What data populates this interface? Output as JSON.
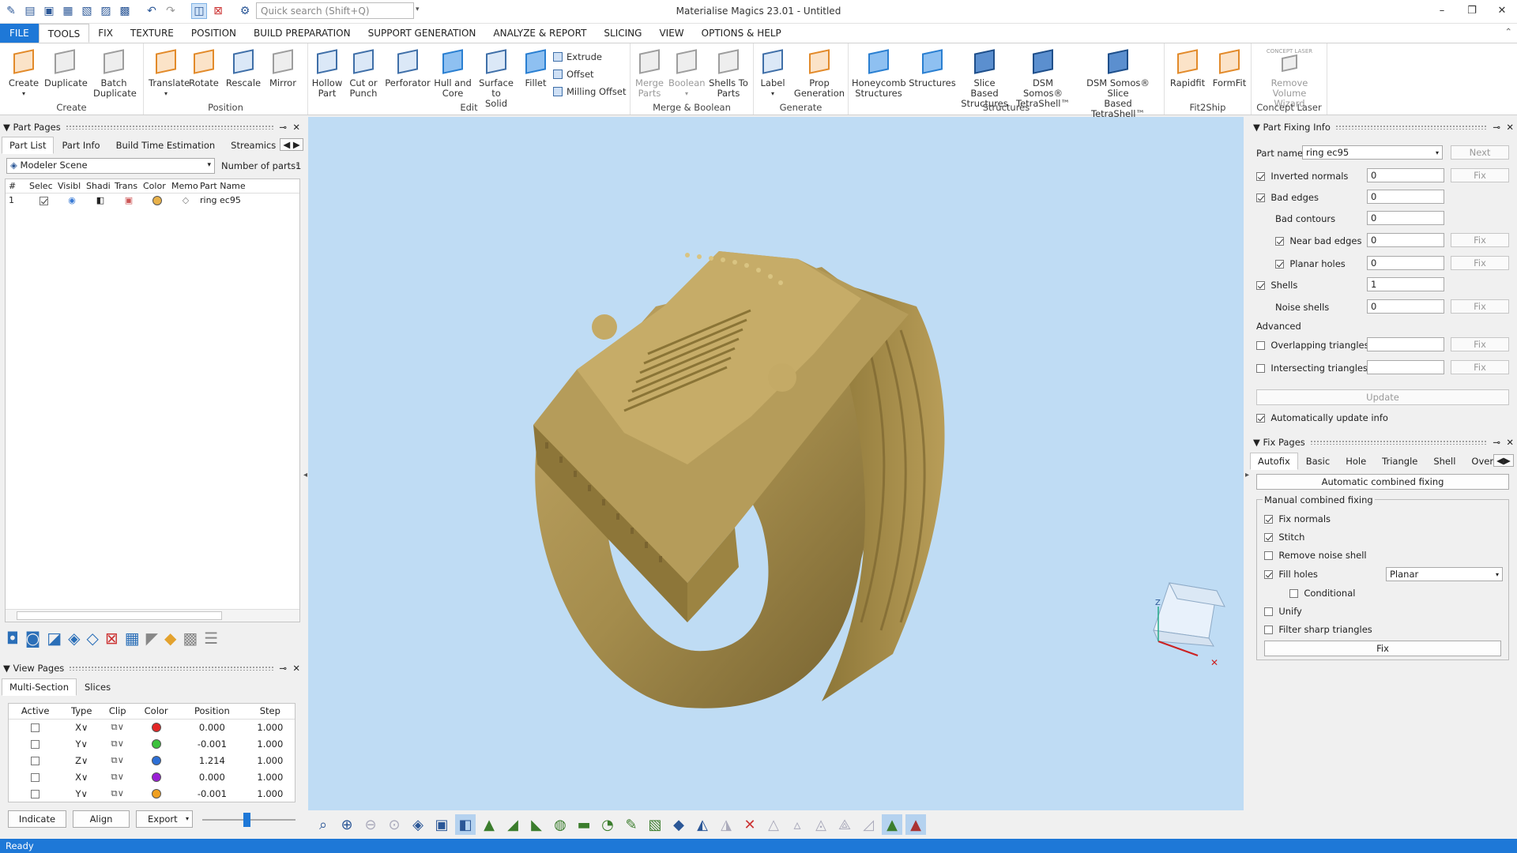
{
  "window": {
    "title": "Materialise Magics 23.01 - Untitled",
    "search_placeholder": "Quick search (Shift+Q)"
  },
  "menu": [
    "FILE",
    "TOOLS",
    "FIX",
    "TEXTURE",
    "POSITION",
    "BUILD PREPARATION",
    "SUPPORT GENERATION",
    "ANALYZE & REPORT",
    "SLICING",
    "VIEW",
    "OPTIONS & HELP"
  ],
  "ribbon": {
    "create": {
      "name": "Create",
      "b1": "Create",
      "b2": "Duplicate",
      "b3a": "Batch",
      "b3b": "Duplicate"
    },
    "position": {
      "name": "Position",
      "b1": "Translate",
      "b2": "Rotate",
      "b3": "Rescale",
      "b4": "Mirror"
    },
    "edit": {
      "name": "Edit",
      "b1a": "Hollow",
      "b1b": "Part",
      "b2a": "Cut or",
      "b2b": "Punch",
      "b3": "Perforator",
      "b4a": "Hull and",
      "b4b": "Core",
      "b5a": "Surface to",
      "b5b": "Solid",
      "b6": "Fillet",
      "s1": "Extrude",
      "s2": "Offset",
      "s3": "Milling Offset"
    },
    "boolean": {
      "name": "Merge & Boolean",
      "b1a": "Merge",
      "b1b": "Parts",
      "b2": "Boolean",
      "b3a": "Shells To",
      "b3b": "Parts"
    },
    "generate": {
      "name": "Generate",
      "b1": "Label",
      "b2a": "Prop",
      "b2b": "Generation"
    },
    "structures": {
      "name": "Structures",
      "b1a": "Honeycomb",
      "b1b": "Structures",
      "b2": "Structures",
      "b3a": "Slice Based",
      "b3b": "Structures",
      "b4a": "DSM Somos®",
      "b4b": "TetraShell™",
      "b5a": "DSM Somos® Slice",
      "b5b": "Based TetraShell™"
    },
    "fit2ship": {
      "name": "Fit2Ship",
      "b1": "Rapidfit",
      "b2": "FormFit"
    },
    "concept": {
      "name": "Concept Laser",
      "b1a": "Remove Volume",
      "b1b": "Wizard",
      "logo": "CONCEPT LASER"
    }
  },
  "part_pages": {
    "title": "Part Pages",
    "tabs": [
      "Part List",
      "Part Info",
      "Build Time Estimation",
      "Streamics Part"
    ],
    "scene": "Modeler Scene",
    "num_parts_label": "Number of parts:",
    "num_parts": "1",
    "columns": [
      "#",
      "Selec",
      "Visibl",
      "Shadi",
      "Trans",
      "Color",
      "Memo",
      "Part Name"
    ],
    "row": {
      "num": "1",
      "name": "ring ec95"
    }
  },
  "view_pages": {
    "title": "View Pages",
    "tabs": [
      "Multi-Section",
      "Slices"
    ],
    "columns": [
      "Active",
      "Type",
      "Clip",
      "Color",
      "Position",
      "Step"
    ],
    "rows": [
      {
        "type": "X",
        "color": "#e32626",
        "position": "0.000",
        "step": "1.000"
      },
      {
        "type": "Y",
        "color": "#3cc23c",
        "position": "-0.001",
        "step": "1.000"
      },
      {
        "type": "Z",
        "color": "#2d6fd6",
        "position": "1.214",
        "step": "1.000"
      },
      {
        "type": "X",
        "color": "#9a1fd6",
        "position": "0.000",
        "step": "1.000"
      },
      {
        "type": "Y",
        "color": "#f0a020",
        "position": "-0.001",
        "step": "1.000"
      }
    ],
    "buttons": {
      "indicate": "Indicate",
      "align": "Align",
      "export": "Export"
    }
  },
  "part_fixing": {
    "title": "Part Fixing Info",
    "part_name_label": "Part name",
    "part_name": "ring ec95",
    "next": "Next",
    "fix": "Fix",
    "inverted_normals": "Inverted normals",
    "inverted_normals_val": "0",
    "bad_edges": "Bad edges",
    "bad_edges_val": "0",
    "bad_contours": "Bad contours",
    "bad_contours_val": "0",
    "near_bad_edges": "Near bad edges",
    "near_bad_edges_val": "0",
    "planar_holes": "Planar holes",
    "planar_holes_val": "0",
    "shells": "Shells",
    "shells_val": "1",
    "noise_shells": "Noise shells",
    "noise_shells_val": "0",
    "advanced": "Advanced",
    "overlapping": "Overlapping triangles",
    "intersecting": "Intersecting triangles",
    "update": "Update",
    "auto_update": "Automatically update info"
  },
  "fix_pages": {
    "title": "Fix Pages",
    "tabs": [
      "Autofix",
      "Basic",
      "Hole",
      "Triangle",
      "Shell",
      "Over"
    ],
    "auto_combined": "Automatic combined fixing",
    "manual_title": "Manual combined fixing",
    "fix_normals": "Fix normals",
    "stitch": "Stitch",
    "remove_noise": "Remove noise shell",
    "fill_holes": "Fill holes",
    "fill_mode": "Planar",
    "conditional": "Conditional",
    "unify": "Unify",
    "filter_sharp": "Filter sharp triangles",
    "fix": "Fix"
  },
  "status": "Ready"
}
